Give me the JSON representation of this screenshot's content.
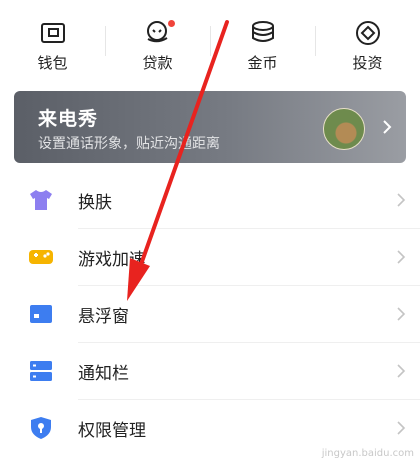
{
  "top_grid": [
    {
      "label": "钱包",
      "icon": "wallet-icon"
    },
    {
      "label": "贷款",
      "icon": "loan-icon",
      "badge": "red-dot"
    },
    {
      "label": "金币",
      "icon": "coin-stack-icon"
    },
    {
      "label": "投资",
      "icon": "invest-icon"
    }
  ],
  "banner": {
    "title": "来电秀",
    "subtitle": "设置通话形象，贴近沟通距离"
  },
  "list": [
    {
      "label": "换肤",
      "icon": "tshirt-icon",
      "color": "#8d7ff0"
    },
    {
      "label": "游戏加速",
      "icon": "gamepad-icon",
      "color": "#f6b400"
    },
    {
      "label": "悬浮窗",
      "icon": "floating-window-icon",
      "color": "#3d7df0"
    },
    {
      "label": "通知栏",
      "icon": "notification-bar-icon",
      "color": "#3d7df0"
    },
    {
      "label": "权限管理",
      "icon": "shield-icon",
      "color": "#3d7df0"
    }
  ],
  "annotation": {
    "arrow_color": "#e8231f"
  },
  "watermark": "jingyan.baidu.com"
}
